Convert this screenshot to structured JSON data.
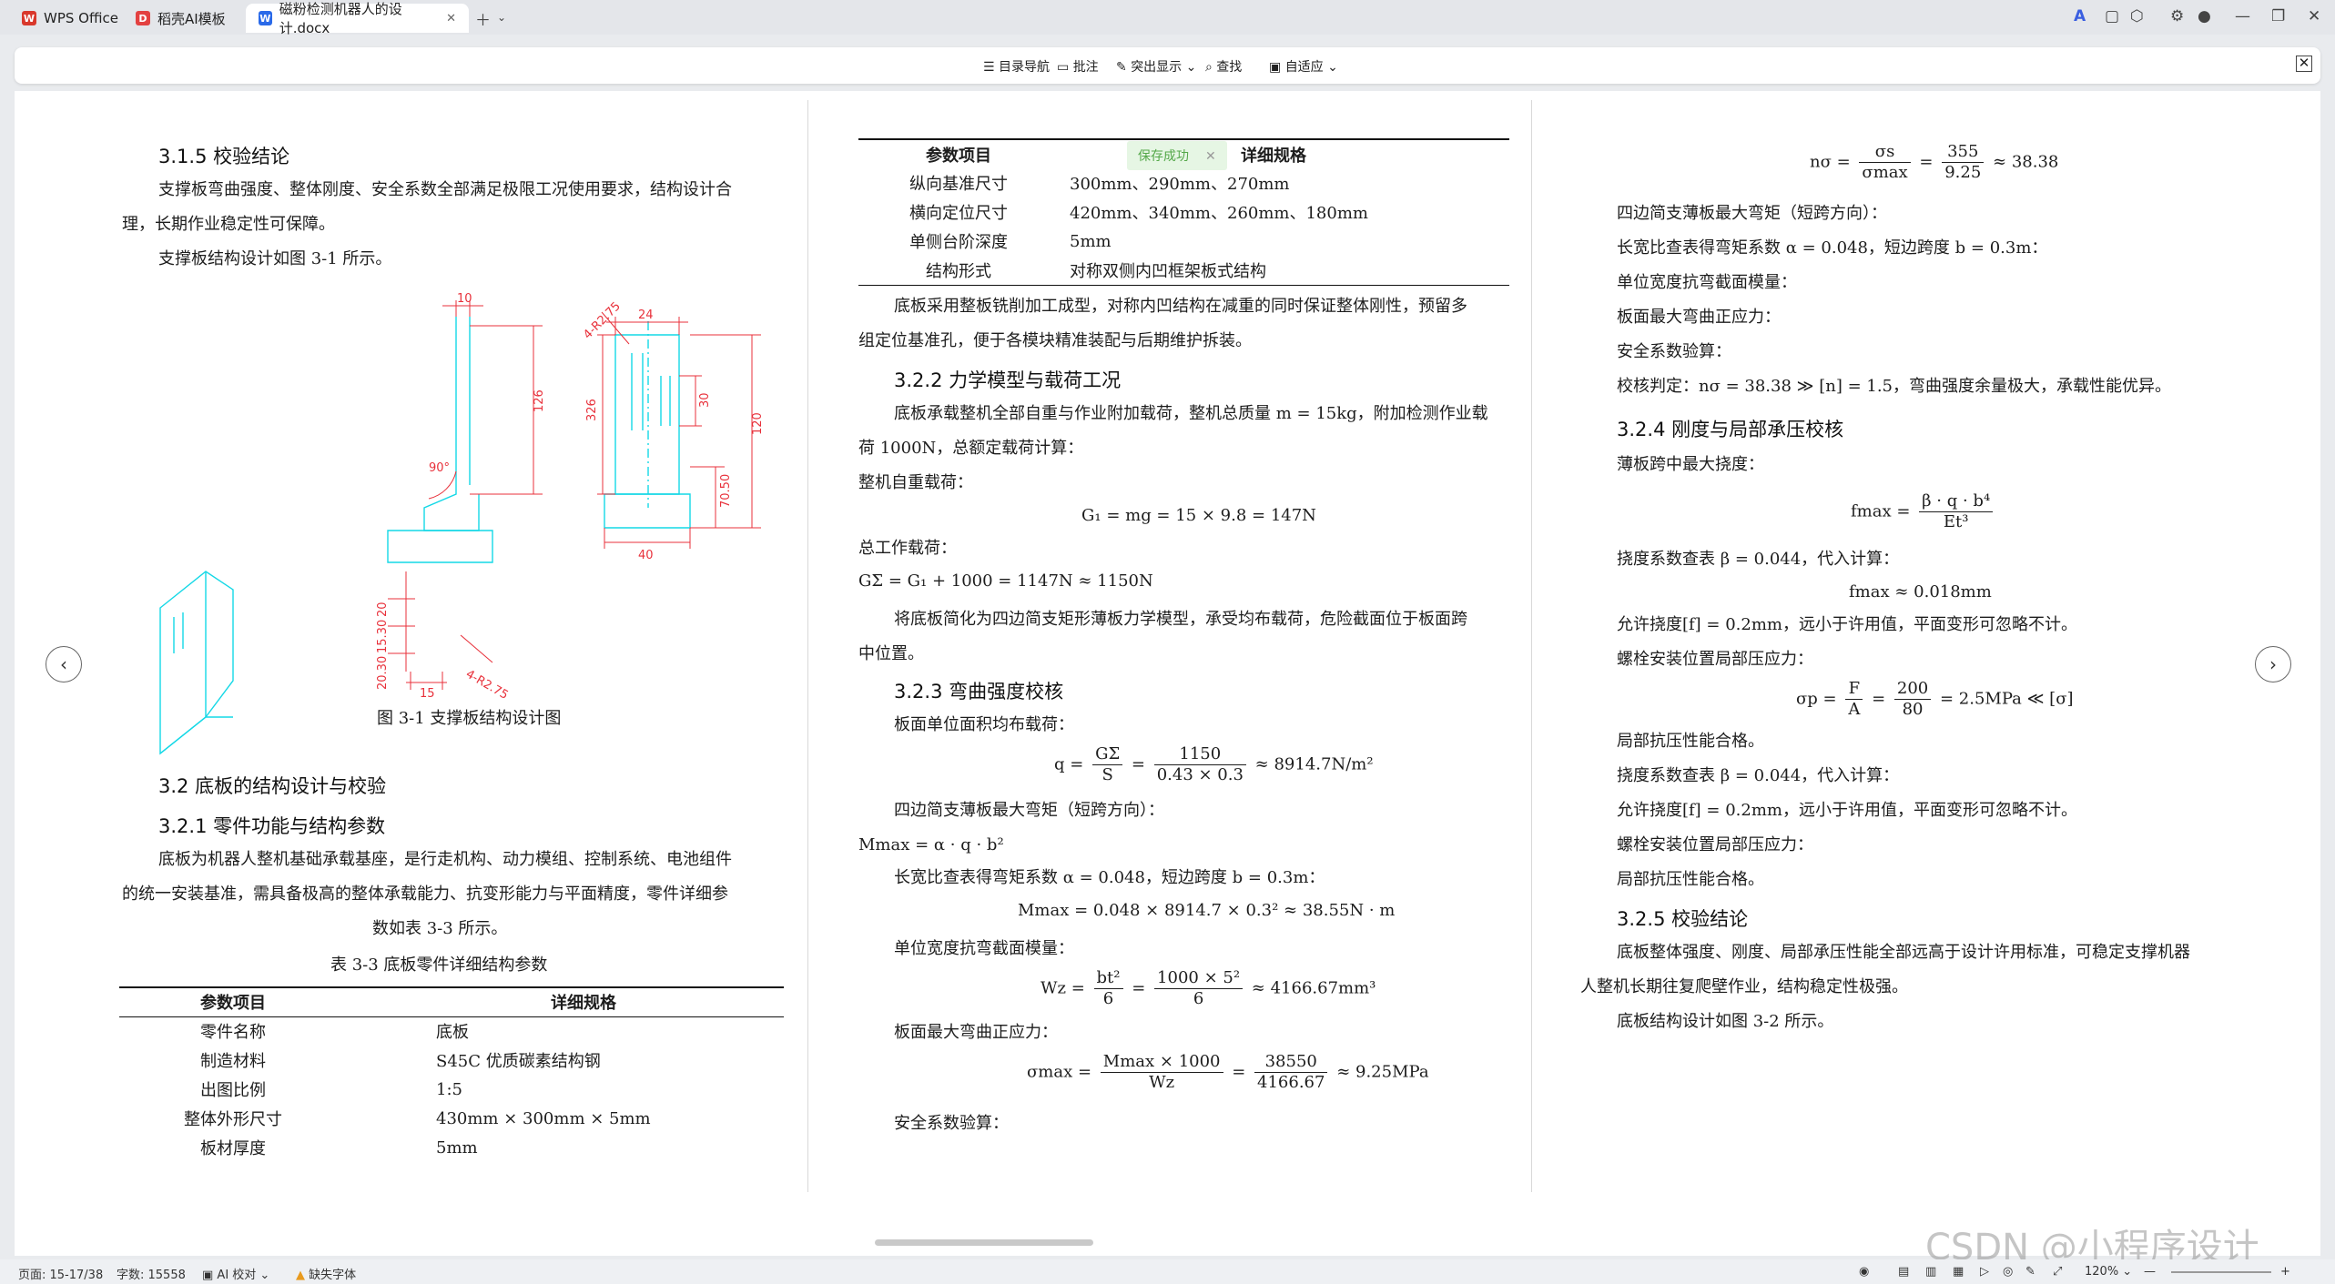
{
  "tabs": [
    {
      "label": "WPS Office",
      "icon": "W"
    },
    {
      "label": "稻壳AI模板",
      "icon": "D"
    },
    {
      "label": "磁粉检测机器人的设计.docx",
      "icon": "W"
    }
  ],
  "toolbar": {
    "items": [
      "目录导航",
      "批注",
      "突出显示",
      "查找",
      "自适应"
    ]
  },
  "toast": "保存成功",
  "col1": {
    "h315": "3.1.5  校验结论",
    "p1": "支撑板弯曲强度、整体刚度、安全系数全部满足极限工况使用要求，结构设计合",
    "p1b": "理，长期作业稳定性可保障。",
    "p2": "支撑板结构设计如图  3-1  所示。",
    "figcap": "图  3-1  支撑板结构设计图",
    "dims": {
      "d10": "10",
      "d24": "24",
      "d126": "126",
      "d326": "326",
      "d30": "30",
      "d120": "120",
      "d70": "70.50",
      "d40": "40",
      "d15": "15",
      "d90": "90°",
      "dr": "4-R2.75",
      "dl1": "20",
      "dl2": "15.30",
      "dl3": "20.30"
    },
    "h32": "3.2  底板的结构设计与校验",
    "h321": "3.2.1  零件功能与结构参数",
    "p3": "底板为机器人整机基础承载基座，是行走机构、动力模组、控制系统、电池组件",
    "p3b": "的统一安装基准，需具备极高的整体承载能力、抗变形能力与平面精度，零件详细参",
    "p3c": "数如表  3-3  所示。",
    "tabcap": "表  3-3  底板零件详细结构参数",
    "table": {
      "headers": [
        "参数项目",
        "详细规格"
      ],
      "rows": [
        [
          "零件名称",
          "底板"
        ],
        [
          "制造材料",
          "S45C  优质碳素结构钢"
        ],
        [
          "出图比例",
          "1:5"
        ],
        [
          "整体外形尺寸",
          "430mm × 300mm × 5mm"
        ],
        [
          "板材厚度",
          "5mm"
        ]
      ]
    }
  },
  "col2": {
    "table": {
      "headers": [
        "参数项目",
        "详细规格"
      ],
      "rows": [
        [
          "纵向基准尺寸",
          "300mm、290mm、270mm"
        ],
        [
          "横向定位尺寸",
          "420mm、340mm、260mm、180mm"
        ],
        [
          "单侧台阶深度",
          "5mm"
        ],
        [
          "结构形式",
          "对称双侧内凹框架板式结构"
        ]
      ]
    },
    "p1": "底板采用整板铣削加工成型，对称内凹结构在减重的同时保证整体刚性，预留多",
    "p1b": "组定位基准孔，便于各模块精准装配与后期维护拆装。",
    "h322": "3.2.2  力学模型与载荷工况",
    "p2": "底板承载整机全部自重与作业附加载荷，整机总质量 m = 15kg，附加检测作业载",
    "p2b": "荷 1000N，总额定载荷计算：",
    "p3": "整机自重载荷：",
    "eq1": "G₁ = mg = 15 × 9.8 = 147N",
    "p4": "总工作载荷：",
    "eq2": "GΣ = G₁ + 1000 = 1147N ≈ 1150N",
    "p5": "将底板简化为四边简支矩形薄板力学模型，承受均布载荷，危险截面位于板面跨",
    "p5b": "中位置。",
    "h323": "3.2.3  弯曲强度校核",
    "p6": "板面单位面积均布载荷：",
    "eq3": {
      "lhs": "q =",
      "n1": "GΣ",
      "d1": "S",
      "n2": "1150",
      "d2": "0.43 × 0.3",
      "rhs": "≈ 8914.7N/m²"
    },
    "p7": "四边简支薄板最大弯矩（短跨方向）：",
    "eq4": "Mmax = α · q · b²",
    "p8": "长宽比查表得弯矩系数 α = 0.048，短边跨度 b = 0.3m：",
    "eq5": "Mmax = 0.048 × 8914.7 × 0.3² ≈ 38.55N · m",
    "p9": "单位宽度抗弯截面模量：",
    "eq6": {
      "lhs": "Wz =",
      "n1": "bt²",
      "d1": "6",
      "n2": "1000 × 5²",
      "d2": "6",
      "rhs": "≈ 4166.67mm³"
    },
    "p10": "板面最大弯曲正应力：",
    "eq7": {
      "lhs": "σmax =",
      "n1": "Mmax × 1000",
      "d1": "Wz",
      "n2": "38550",
      "d2": "4166.67",
      "rhs": "≈ 9.25MPa"
    },
    "p11": "安全系数验算："
  },
  "col3": {
    "eq1": {
      "lhs": "nσ =",
      "n1": "σs",
      "d1": "σmax",
      "n2": "355",
      "d2": "9.25",
      "rhs": "≈ 38.38"
    },
    "p1": "四边简支薄板最大弯矩（短跨方向）：",
    "p2": "长宽比查表得弯矩系数 α = 0.048，短边跨度 b = 0.3m：",
    "p3": "单位宽度抗弯截面模量：",
    "p4": "板面最大弯曲正应力：",
    "p5": "安全系数验算：",
    "p6": "校核判定：nσ = 38.38 ≫ [n] = 1.5，弯曲强度余量极大，承载性能优异。",
    "h324": "3.2.4  刚度与局部承压校核",
    "p7": "薄板跨中最大挠度：",
    "eq2": {
      "lhs": "fmax =",
      "n1": "β · q · b⁴",
      "d1": "Et³"
    },
    "p8": "挠度系数查表 β = 0.044，代入计算：",
    "eq3": "fmax ≈ 0.018mm",
    "p9": "允许挠度[f] = 0.2mm，远小于许用值，平面变形可忽略不计。",
    "p10": "螺栓安装位置局部压应力：",
    "eq4": {
      "lhs": "σp =",
      "n1": "F",
      "d1": "A",
      "n2": "200",
      "d2": "80",
      "rhs": "= 2.5MPa ≪ [σ]"
    },
    "p11": "局部抗压性能合格。",
    "p12": "挠度系数查表 β = 0.044，代入计算：",
    "p13": "允许挠度[f] = 0.2mm，远小于许用值，平面变形可忽略不计。",
    "p14": "螺栓安装位置局部压应力：",
    "p15": "局部抗压性能合格。",
    "h325": "3.2.5  校验结论",
    "p16": "底板整体强度、刚度、局部承压性能全部远高于设计许用标准，可稳定支撑机器",
    "p16b": "人整机长期往复爬壁作业，结构稳定性极强。",
    "p17": "底板结构设计如图  3-2  所示。"
  },
  "status": {
    "page": "页面: 15-17/38",
    "words": "字数: 15558",
    "ai": "AI 校对",
    "font": "缺失字体",
    "zoom": "120%"
  },
  "watermark": "CSDN @小程序设计"
}
